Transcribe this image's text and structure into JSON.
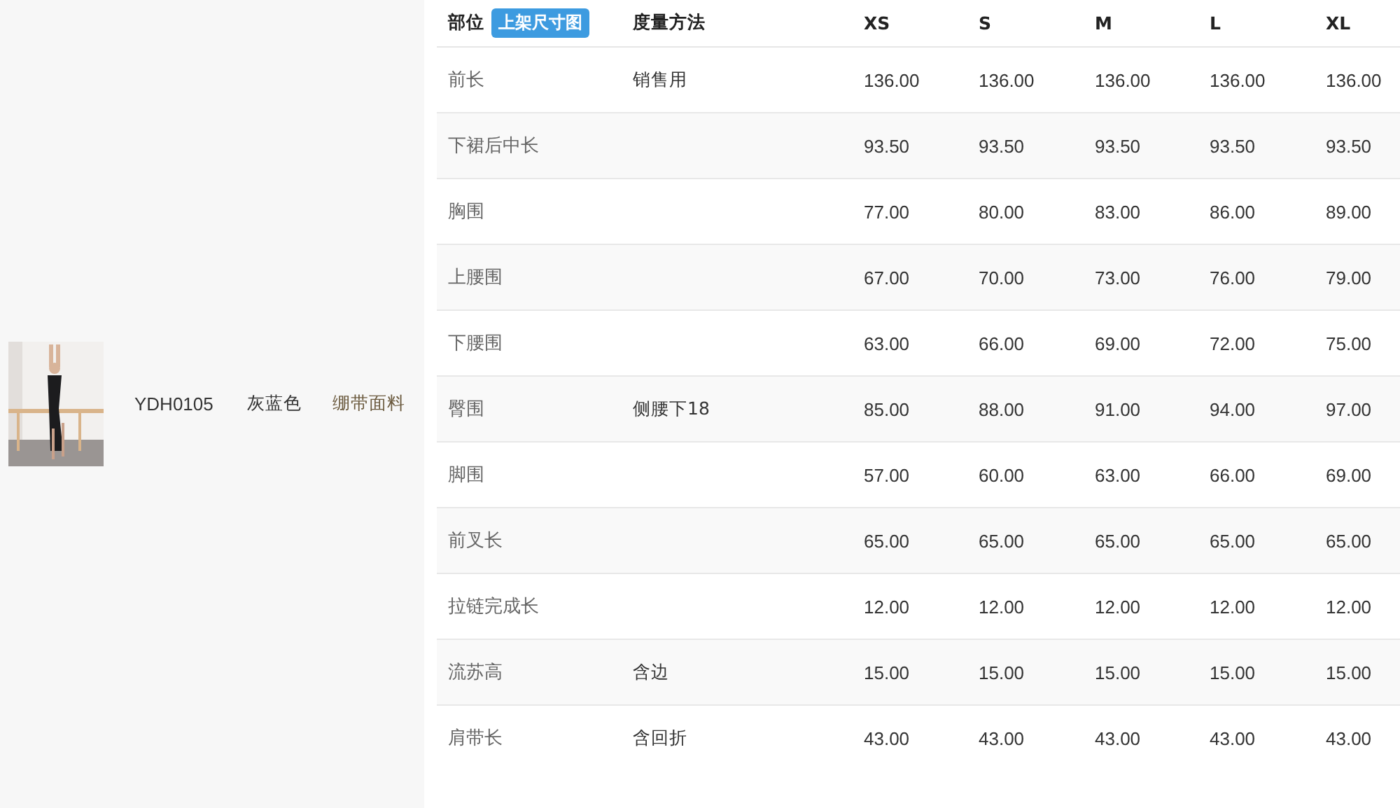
{
  "product": {
    "code": "YDH0105",
    "color_name": "灰蓝色",
    "fabric": "绷带面料"
  },
  "size_table": {
    "columns": [
      {
        "label": "部位",
        "badge": "上架尺寸图"
      },
      {
        "label": "度量方法"
      },
      {
        "label": "XS"
      },
      {
        "label": "S"
      },
      {
        "label": "M"
      },
      {
        "label": "L"
      },
      {
        "label": "XL"
      }
    ],
    "rows": [
      {
        "part": "前长",
        "method": "销售用",
        "values": [
          "136.00",
          "136.00",
          "136.00",
          "136.00",
          "136.00"
        ]
      },
      {
        "part": "下裙后中长",
        "values": [
          "93.50",
          "93.50",
          "93.50",
          "93.50",
          "93.50"
        ]
      },
      {
        "part": "胸围",
        "values": [
          "77.00",
          "80.00",
          "83.00",
          "86.00",
          "89.00"
        ]
      },
      {
        "part": "上腰围",
        "values": [
          "67.00",
          "70.00",
          "73.00",
          "76.00",
          "79.00"
        ]
      },
      {
        "part": "下腰围",
        "values": [
          "63.00",
          "66.00",
          "69.00",
          "72.00",
          "75.00"
        ]
      },
      {
        "part": "臀围",
        "method": "侧腰下18",
        "values": [
          "85.00",
          "88.00",
          "91.00",
          "94.00",
          "97.00"
        ]
      },
      {
        "part": "脚围",
        "values": [
          "57.00",
          "60.00",
          "63.00",
          "66.00",
          "69.00"
        ]
      },
      {
        "part": "前叉长",
        "values": [
          "65.00",
          "65.00",
          "65.00",
          "65.00",
          "65.00"
        ]
      },
      {
        "part": "拉链完成长",
        "values": [
          "12.00",
          "12.00",
          "12.00",
          "12.00",
          "12.00"
        ]
      },
      {
        "part": "流苏高",
        "method": "含边",
        "values": [
          "15.00",
          "15.00",
          "15.00",
          "15.00",
          "15.00"
        ]
      },
      {
        "part": "肩带长",
        "method": "含回折",
        "values": [
          "43.00",
          "43.00",
          "43.00",
          "43.00",
          "43.00"
        ]
      }
    ]
  }
}
